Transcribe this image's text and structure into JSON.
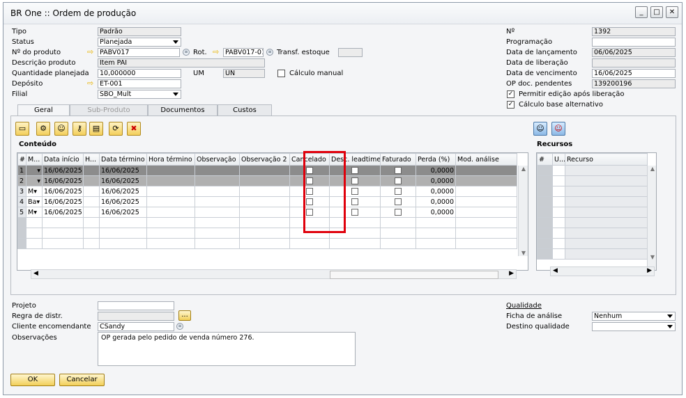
{
  "window": {
    "title": "BR One :: Ordem de produção"
  },
  "header_left": {
    "tipo_label": "Tipo",
    "tipo_value": "Padrão",
    "status_label": "Status",
    "status_value": "Planejada",
    "produto_label": "Nº do produto",
    "produto_value": "PABV017",
    "rot_label": "Rot.",
    "rot_value": "PABV017-01",
    "transf_label": "Transf. estoque",
    "transf_value": "",
    "desc_label": "Descrição produto",
    "desc_value": "Item PAI",
    "qtd_label": "Quantidade planejada",
    "qtd_value": "10,000000",
    "um_label": "UM",
    "um_value": "UN",
    "calc_manual_label": "Cálculo manual",
    "deposito_label": "Depósito",
    "deposito_value": "ET-001",
    "filial_label": "Filial",
    "filial_value": "SBO_Mult"
  },
  "header_right": {
    "num_label": "Nº",
    "num_value": "1392",
    "prog_label": "Programação",
    "prog_value": "",
    "lanc_label": "Data de lançamento",
    "lanc_value": "06/06/2025",
    "lib_label": "Data de liberação",
    "lib_value": "",
    "venc_label": "Data de vencimento",
    "venc_value": "16/06/2025",
    "op_label": "OP doc. pendentes",
    "op_value": "139200196",
    "permitir_label": "Permitir edição após liberação",
    "calculo_label": "Cálculo base alternativo"
  },
  "tabs": [
    "Geral",
    "Sub-Produto",
    "Documentos",
    "Custos"
  ],
  "toolbar_icons": [
    "folder-icon",
    "gear-icon",
    "users-icon",
    "key-icon",
    "stack-icon",
    "refresh-icon",
    "delete-icon"
  ],
  "conteudo": {
    "title": "Conteúdo",
    "columns": [
      "#",
      "M...",
      "Data início",
      "H...",
      "Data término",
      "Hora término",
      "Observação",
      "Observação 2",
      "Cancelado",
      "Desc. leadtime",
      "Faturado",
      "Perda (%)",
      "Mod. análise"
    ],
    "rows": [
      {
        "n": "1",
        "pre": "",
        "m": "",
        "inicio": "16/06/2025",
        "termino": "16/06/2025",
        "perda": "0,0000"
      },
      {
        "n": "2",
        "pre": "",
        "m": "",
        "inicio": "16/06/2025",
        "termino": "16/06/2025",
        "perda": "0,0000"
      },
      {
        "n": "3",
        "pre": "",
        "m": "M",
        "inicio": "16/06/2025",
        "termino": "16/06/2025",
        "perda": "0,0000"
      },
      {
        "n": "4",
        "pre": "1",
        "m": "Ba",
        "inicio": "16/06/2025",
        "termino": "16/06/2025",
        "perda": "0,0000"
      },
      {
        "n": "5",
        "pre": "1",
        "m": "M",
        "inicio": "16/06/2025",
        "termino": "16/06/2025",
        "perda": "0,0000"
      }
    ]
  },
  "recursos": {
    "title": "Recursos",
    "columns": [
      "#",
      "U...",
      "Recurso"
    ]
  },
  "bottom": {
    "projeto_label": "Projeto",
    "projeto_value": "",
    "regra_label": "Regra de distr.",
    "regra_value": "",
    "regra_btn": "...",
    "cliente_label": "Cliente encomendante",
    "cliente_value": "CSandy",
    "obs_label": "Observações",
    "obs_value": "OP gerada pelo pedido de venda número 276.",
    "qualidade_label": "Qualidade",
    "ficha_label": "Ficha de análise",
    "ficha_value": "Nenhum",
    "destino_label": "Destino qualidade",
    "destino_value": ""
  },
  "buttons": {
    "ok": "OK",
    "cancel": "Cancelar"
  },
  "colors": {
    "highlight": "#e0000b",
    "button": "#f2cf59"
  }
}
